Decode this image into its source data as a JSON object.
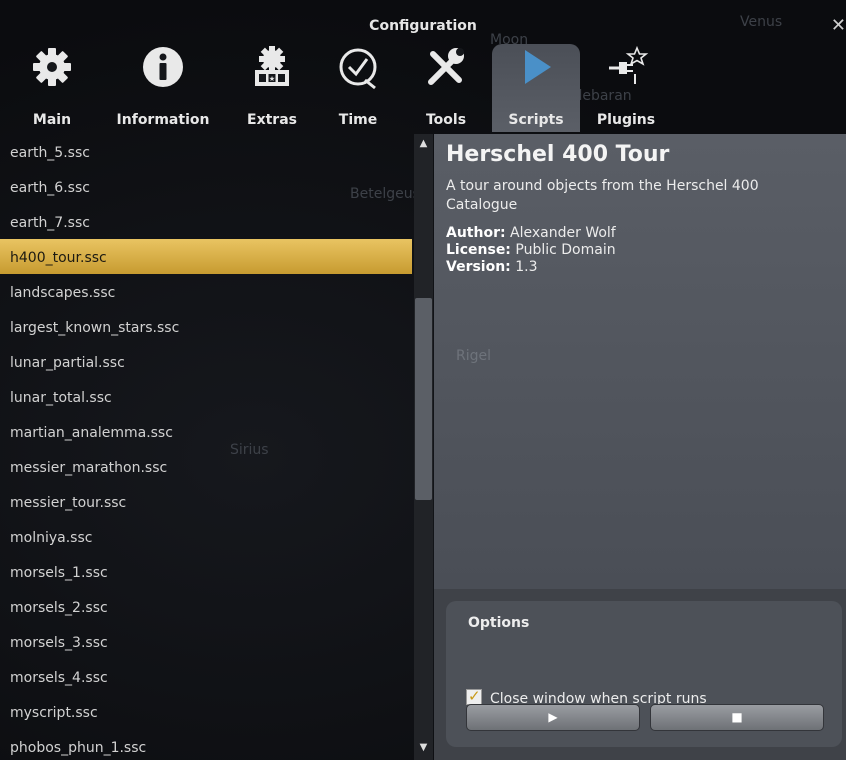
{
  "window": {
    "title": "Configuration",
    "close_glyph": "✕"
  },
  "tabs": [
    {
      "label": "Main",
      "icon": "gear-icon"
    },
    {
      "label": "Information",
      "icon": "info-icon"
    },
    {
      "label": "Extras",
      "icon": "extras-icon"
    },
    {
      "label": "Time",
      "icon": "clock-icon"
    },
    {
      "label": "Tools",
      "icon": "tools-icon"
    },
    {
      "label": "Scripts",
      "icon": "play-icon",
      "active": true
    },
    {
      "label": "Plugins",
      "icon": "plugin-icon"
    }
  ],
  "scripts": [
    "earth_5.ssc",
    "earth_6.ssc",
    "earth_7.ssc",
    "h400_tour.ssc",
    "landscapes.ssc",
    "largest_known_stars.ssc",
    "lunar_partial.ssc",
    "lunar_total.ssc",
    "martian_analemma.ssc",
    "messier_marathon.ssc",
    "messier_tour.ssc",
    "molniya.ssc",
    "morsels_1.ssc",
    "morsels_2.ssc",
    "morsels_3.ssc",
    "morsels_4.ssc",
    "myscript.ssc",
    "phobos_phun_1.ssc"
  ],
  "selected_index": 3,
  "details": {
    "name": "Herschel 400 Tour",
    "description": "A tour around objects from the Herschel 400 Catalogue",
    "author_label": "Author:",
    "author": "Alexander Wolf",
    "license_label": "License:",
    "license": "Public Domain",
    "version_label": "Version:",
    "version": "1.3"
  },
  "options": {
    "title": "Options",
    "close_window_label": "Close window when script runs",
    "close_window_checked": true,
    "run_glyph": "▶",
    "stop_glyph": "■"
  },
  "sky_labels": [
    "Venus",
    "Moon",
    "Aldebaran",
    "Betelgeuse",
    "Rigel",
    "Sirius"
  ],
  "colors": {
    "selection": "#d9b14a",
    "accent_active_tab": "#555962"
  }
}
